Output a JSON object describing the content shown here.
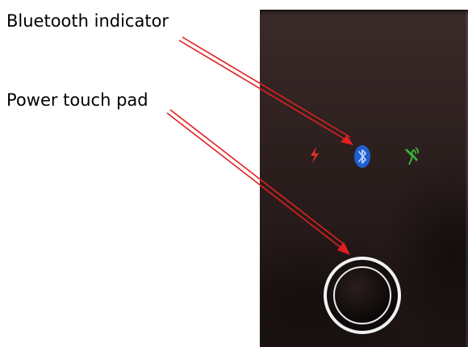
{
  "labels": {
    "bluetooth": "Bluetooth indicator",
    "power": "Power touch pad"
  },
  "icons": {
    "charge": "lightning-bolt-icon",
    "bluetooth": "bluetooth-icon",
    "network": "network-signal-icon"
  },
  "colors": {
    "arrow": "#e02020",
    "charge": "#e8302a",
    "bluetooth": "#1f5fd0",
    "network": "#3cae3a",
    "device_bg": "#2e2120",
    "pad_ring": "#f2f2f2"
  }
}
